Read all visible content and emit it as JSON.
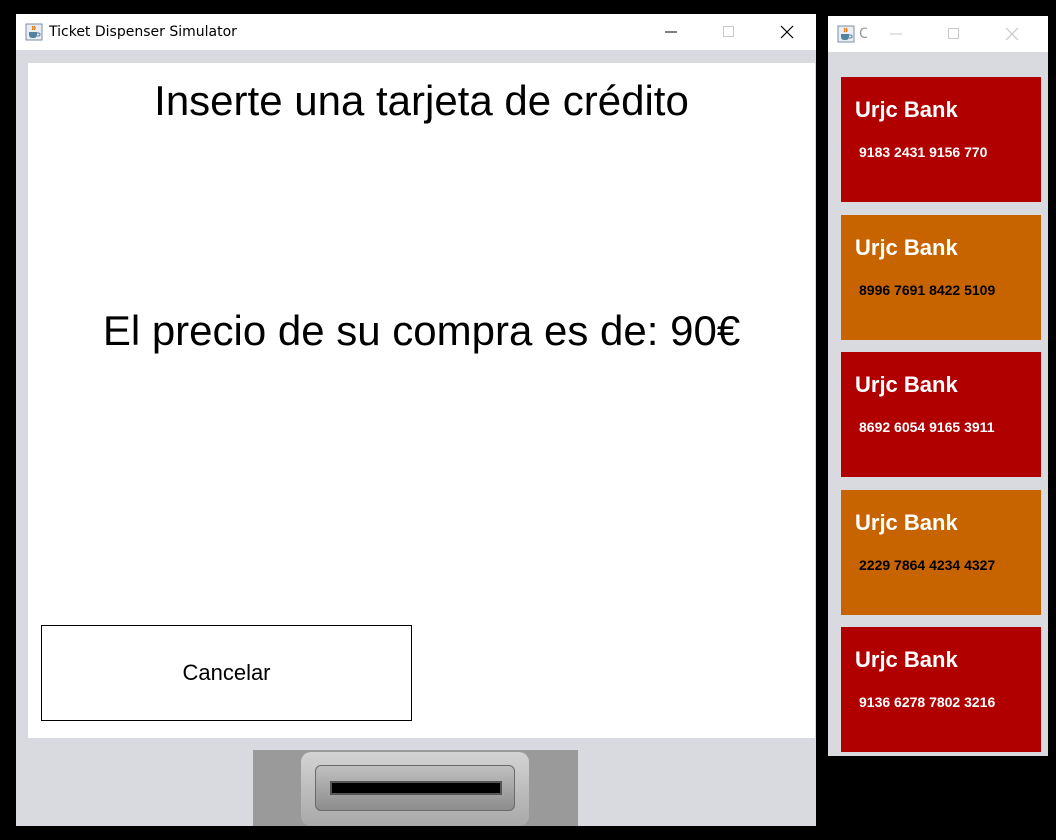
{
  "main_window": {
    "title": "Ticket Dispenser Simulator",
    "insert_prompt": "Inserte una tarjeta de crédito",
    "price_text": "El precio de su compra es de: 90€",
    "cancel_label": "Cancelar"
  },
  "cards_window": {
    "title": "C",
    "cards": [
      {
        "bank": "Urjc Bank",
        "number": "9183 2431 9156 770",
        "color": "#b00000"
      },
      {
        "bank": "Urjc Bank",
        "number": "8996 7691 8422 5109",
        "color": "#c86400"
      },
      {
        "bank": "Urjc Bank",
        "number": "8692 6054 9165 3911",
        "color": "#b00000"
      },
      {
        "bank": "Urjc Bank",
        "number": "2229 7864 4234 4327",
        "color": "#c86400"
      },
      {
        "bank": "Urjc Bank",
        "number": "9136 6278 7802 3216",
        "color": "#b00000"
      }
    ]
  },
  "icons": {
    "app": "java-coffee-cup-icon",
    "minimize": "minimize-icon",
    "maximize": "maximize-icon",
    "close": "close-icon",
    "slot": "card-slot-icon"
  }
}
